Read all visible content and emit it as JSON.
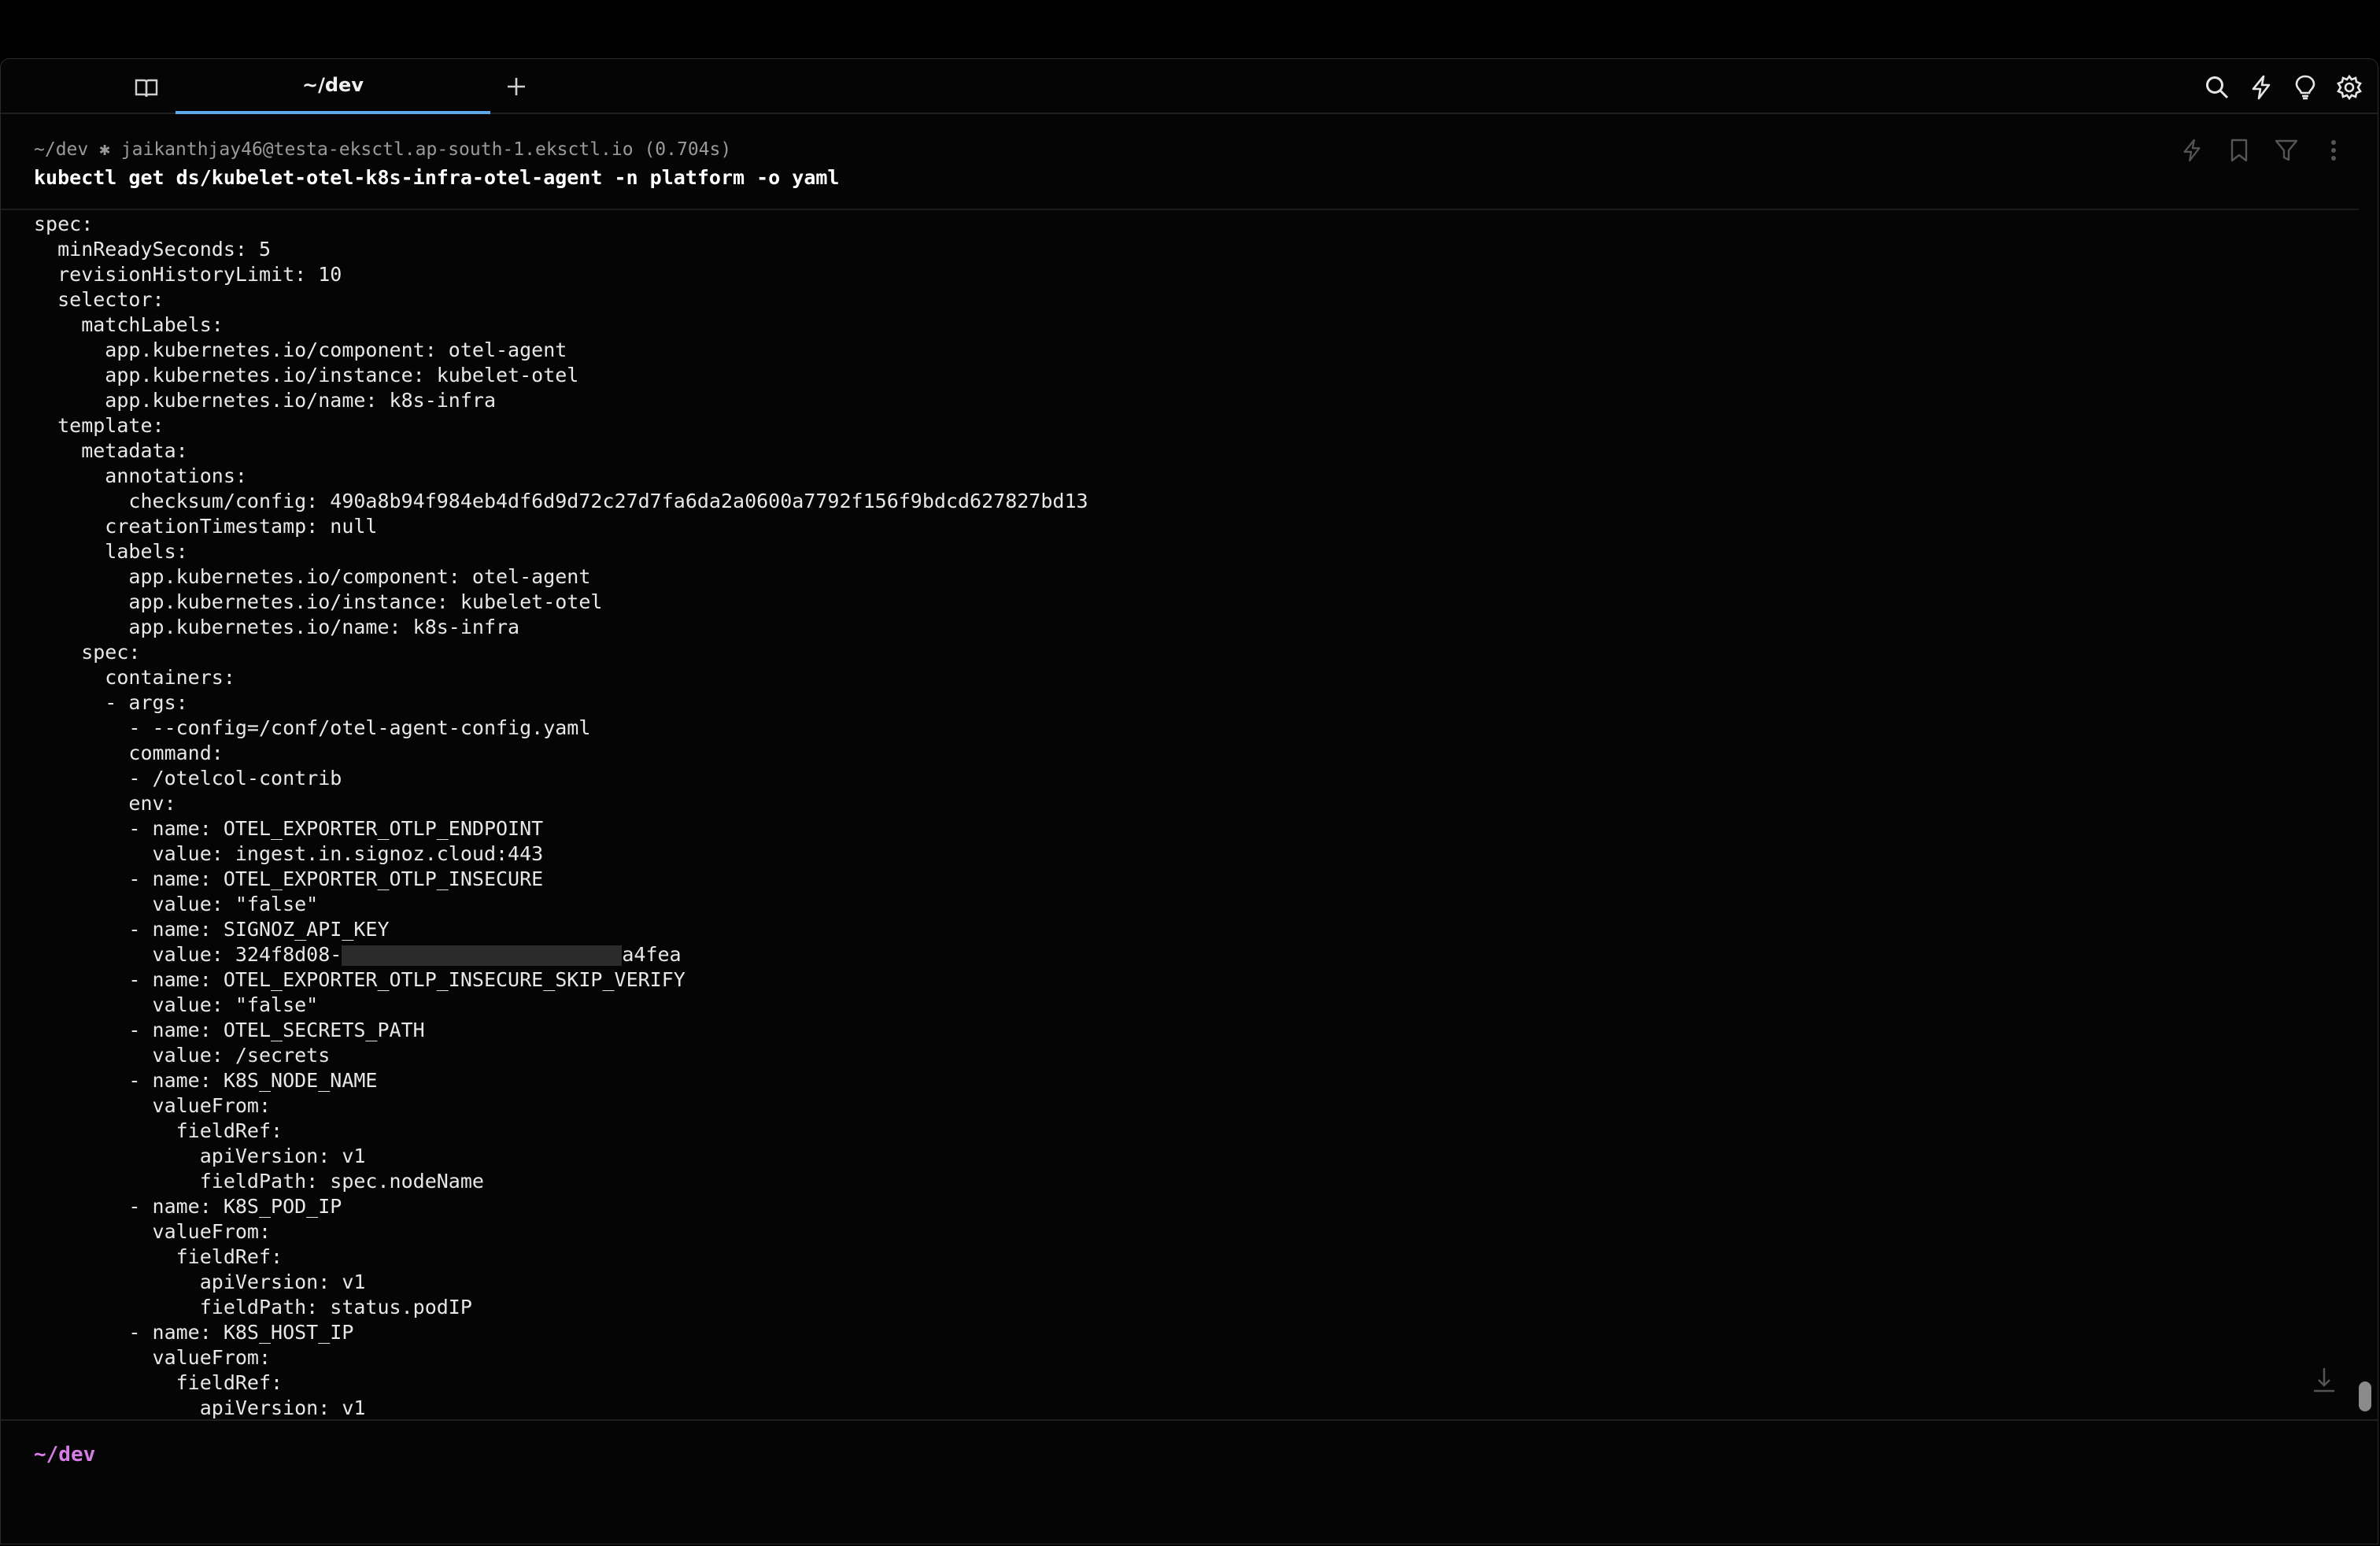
{
  "tab": {
    "title": "~/dev"
  },
  "block": {
    "prompt": "~/dev ✱ jaikanthjay46@testa-eksctl.ap-south-1.eksctl.io (0.704s)",
    "command": "kubectl get ds/kubelet-otel-k8s-infra-otel-agent -n platform -o yaml"
  },
  "output_lines": [
    "spec:",
    "  minReadySeconds: 5",
    "  revisionHistoryLimit: 10",
    "  selector:",
    "    matchLabels:",
    "      app.kubernetes.io/component: otel-agent",
    "      app.kubernetes.io/instance: kubelet-otel",
    "      app.kubernetes.io/name: k8s-infra",
    "  template:",
    "    metadata:",
    "      annotations:",
    "        checksum/config: 490a8b94f984eb4df6d9d72c27d7fa6da2a0600a7792f156f9bdcd627827bd13",
    "      creationTimestamp: null",
    "      labels:",
    "        app.kubernetes.io/component: otel-agent",
    "        app.kubernetes.io/instance: kubelet-otel",
    "        app.kubernetes.io/name: k8s-infra",
    "    spec:",
    "      containers:",
    "      - args:",
    "        - --config=/conf/otel-agent-config.yaml",
    "        command:",
    "        - /otelcol-contrib",
    "        env:",
    "        - name: OTEL_EXPORTER_OTLP_ENDPOINT",
    "          value: ingest.in.signoz.cloud:443",
    "        - name: OTEL_EXPORTER_OTLP_INSECURE",
    "          value: \"false\"",
    "        - name: SIGNOZ_API_KEY",
    "__REDACTED__",
    "        - name: OTEL_EXPORTER_OTLP_INSECURE_SKIP_VERIFY",
    "          value: \"false\"",
    "        - name: OTEL_SECRETS_PATH",
    "          value: /secrets",
    "        - name: K8S_NODE_NAME",
    "          valueFrom:",
    "            fieldRef:",
    "              apiVersion: v1",
    "              fieldPath: spec.nodeName",
    "        - name: K8S_POD_IP",
    "          valueFrom:",
    "            fieldRef:",
    "              apiVersion: v1",
    "              fieldPath: status.podIP",
    "        - name: K8S_HOST_IP",
    "          valueFrom:",
    "            fieldRef:",
    "              apiVersion: v1"
  ],
  "redacted_line": {
    "before": "          value: 324f8d08-",
    "after": "a4fea"
  },
  "input": {
    "prompt": "~/dev"
  },
  "colors": {
    "background": "#050505",
    "tab_underline": "#5fa8e8",
    "input_prompt": "#d77ee6",
    "text": "#e8e8e8",
    "muted_text": "#9a9a9a"
  },
  "icons": {
    "tab_toggle": "book-open-icon",
    "new_tab": "plus-icon",
    "tab_actions": [
      "search-icon",
      "lightning-icon",
      "lightbulb-icon",
      "gear-icon"
    ],
    "block_actions": [
      "lightning-icon",
      "bookmark-icon",
      "filter-icon",
      "more-vertical-icon"
    ],
    "scroll": "arrow-down-to-line-icon"
  }
}
